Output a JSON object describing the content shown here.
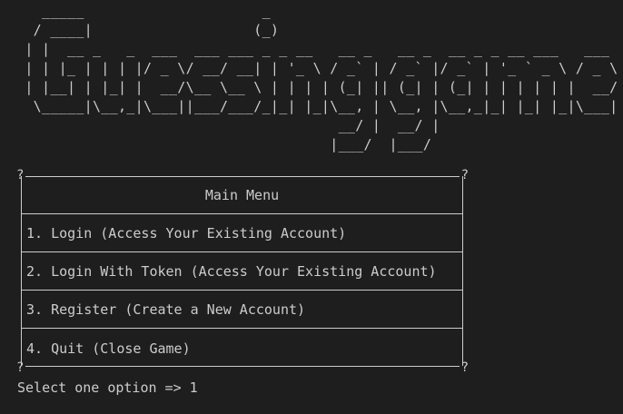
{
  "terminal": {
    "banner_ascii": "   _____                     _             \n  / ____|                   (_)            \n | |  __ _   _  ___  ___ ___ _ _ __   __ _   __ _  __ _ _ __ ___   ___ \n | | |_ | | | |/ _ \\/ __/ __| | '_ \\ / _` | / _` |/ _` | '_ ` _ \\ / _ \\\n | |__| | |_| |  __/\\__ \\__ \\ | | | | (_| || (_| | (_| | | | | | |  __/\n  \\_____|\\__,_|\\___||___/___/_|_| |_|\\__, | \\__, |\\__,_|_| |_| |_|\\___|\n                                      __/ |  __/ |                    \n                                     |___/  |___/                     ",
    "banner_text": "Guessing game",
    "corner_glyph": "?",
    "menu": {
      "header": "Main Menu",
      "options": [
        "1. Login (Access Your Existing Account)",
        "2. Login With Token (Access Your Existing Account)",
        "3. Register (Create a New Account)",
        "4. Quit (Close Game)"
      ]
    },
    "prompt": {
      "label": "Select one option => ",
      "input_value": "1"
    },
    "colors": {
      "background": "#1e1e1e",
      "foreground": "#cccccc"
    }
  }
}
